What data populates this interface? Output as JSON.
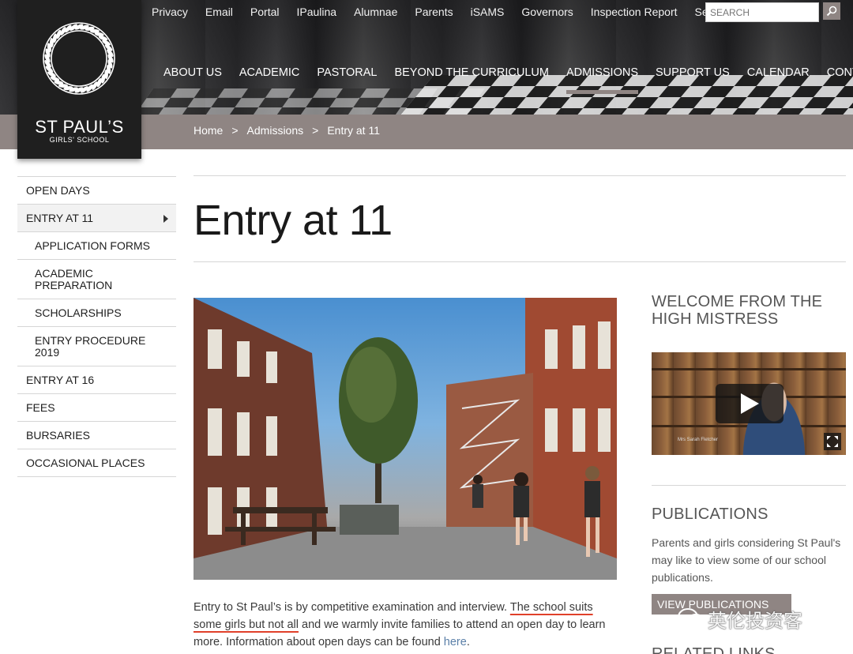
{
  "logo": {
    "name": "ST PAUL’S",
    "sub": "GIRLS' SCHOOL"
  },
  "utility_nav": [
    "Privacy",
    "Email",
    "Portal",
    "IPaulina",
    "Alumnae",
    "Parents",
    "iSAMS",
    "Governors",
    "Inspection Report",
    "Seniors"
  ],
  "search": {
    "placeholder": "SEARCH"
  },
  "main_nav": [
    {
      "label": "ABOUT US",
      "active": false
    },
    {
      "label": "ACADEMIC",
      "active": false
    },
    {
      "label": "PASTORAL",
      "active": false
    },
    {
      "label": "BEYOND THE CURRICULUM",
      "active": false
    },
    {
      "label": "ADMISSIONS",
      "active": true
    },
    {
      "label": "SUPPORT US",
      "active": false
    },
    {
      "label": "CALENDAR",
      "active": false
    },
    {
      "label": "CONTACT",
      "active": false
    }
  ],
  "breadcrumb": {
    "home": "Home",
    "section": "Admissions",
    "current": "Entry at 11",
    "separator": ">"
  },
  "sidebar": {
    "items": [
      {
        "label": "OPEN DAYS",
        "sub": false,
        "active": false
      },
      {
        "label": "ENTRY AT 11",
        "sub": false,
        "active": true
      },
      {
        "label": "APPLICATION FORMS",
        "sub": true,
        "active": false
      },
      {
        "label": "ACADEMIC PREPARATION",
        "sub": true,
        "active": false
      },
      {
        "label": "SCHOLARSHIPS",
        "sub": true,
        "active": false
      },
      {
        "label": "ENTRY PROCEDURE 2019",
        "sub": true,
        "active": false
      },
      {
        "label": "ENTRY AT 16",
        "sub": false,
        "active": false
      },
      {
        "label": "FEES",
        "sub": false,
        "active": false
      },
      {
        "label": "BURSARIES",
        "sub": false,
        "active": false
      },
      {
        "label": "OCCASIONAL PLACES",
        "sub": false,
        "active": false
      }
    ]
  },
  "page": {
    "title": "Entry at 11",
    "intro_a": "Entry to St Paul’s is by competitive examination and interview. ",
    "intro_highlight": "The school suits some girls but not all",
    "intro_b": " and we warmly invite families to attend an open day to learn more. Information about open days can be found ",
    "intro_link": "here",
    "intro_end": "."
  },
  "right": {
    "welcome_title": "WELCOME FROM THE HIGH MISTRESS",
    "video_caption": "Mrs Sarah Fletcher",
    "publications_title": "PUBLICATIONS",
    "publications_text": "Parents and girls considering St Paul's may like to view some of our school publications.",
    "publications_button": "VIEW PUBLICATIONS",
    "related_title": "RELATED LINKS"
  },
  "watermark": "英伦投资客",
  "colors": {
    "accent": "#8f8583",
    "logo_bg": "#1f1f1f",
    "link": "#5a7fa8",
    "highlight_underline": "#e0402a"
  }
}
